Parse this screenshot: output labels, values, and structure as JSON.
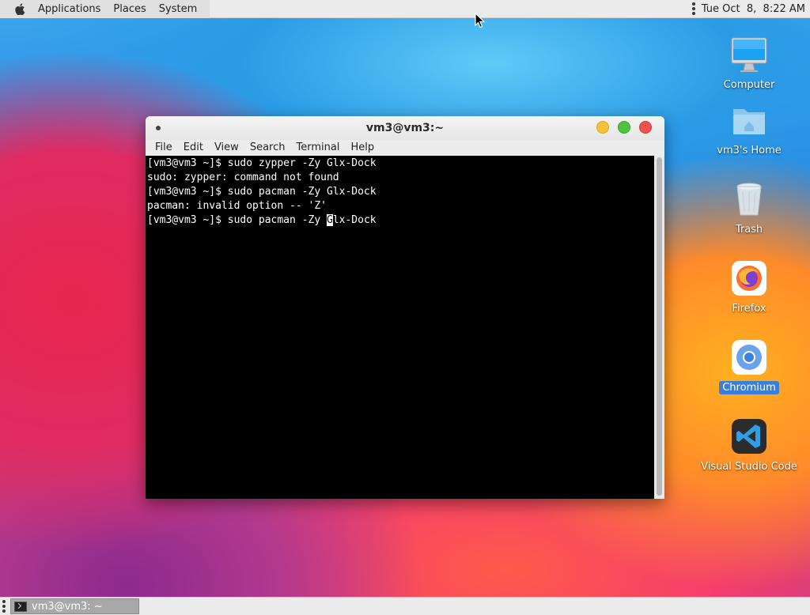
{
  "top_panel": {
    "menus": [
      "Applications",
      "Places",
      "System"
    ],
    "clock": "Tue Oct  8,  8:22 AM"
  },
  "desktop": {
    "icons": [
      {
        "label": "Computer",
        "icon": "computer-icon",
        "selected": false
      },
      {
        "label": "vm3's Home",
        "icon": "home-folder-icon",
        "selected": false
      },
      {
        "label": "Trash",
        "icon": "trash-icon",
        "selected": false
      },
      {
        "label": "Firefox",
        "icon": "firefox-icon",
        "selected": false
      },
      {
        "label": "Chromium",
        "icon": "chromium-icon",
        "selected": true
      },
      {
        "label": "Visual Studio Code",
        "icon": "vscode-icon",
        "selected": false
      }
    ]
  },
  "terminal": {
    "title": "vm3@vm3:~",
    "menus": [
      "File",
      "Edit",
      "View",
      "Search",
      "Terminal",
      "Help"
    ],
    "lines": [
      "[vm3@vm3 ~]$ sudo zypper -Zy Glx-Dock",
      "sudo: zypper: command not found",
      "[vm3@vm3 ~]$ sudo pacman -Zy Glx-Dock",
      "pacman: invalid option -- 'Z'"
    ],
    "current_line": {
      "before_cursor": "[vm3@vm3 ~]$ sudo pacman -Zy ",
      "cursor_char": "G",
      "after_cursor": "lx-Dock"
    }
  },
  "taskbar": {
    "items": [
      {
        "label": "vm3@vm3: ~",
        "icon": "terminal-icon"
      }
    ]
  },
  "colors": {
    "panel": "#ebebeb",
    "terminal_bg": "#000000",
    "terminal_fg": "#ffffff",
    "selection": "#3b7ed8"
  }
}
